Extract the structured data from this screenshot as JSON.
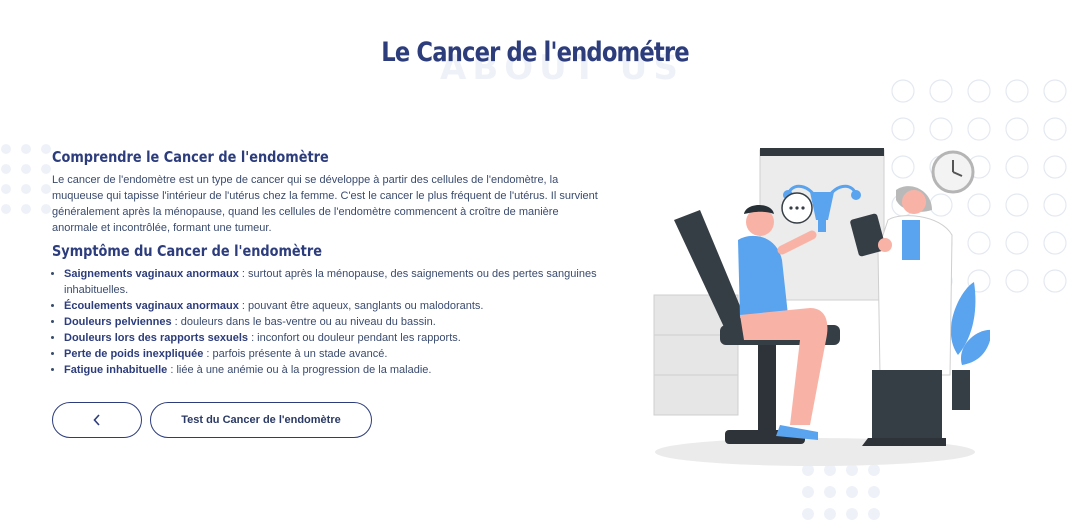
{
  "page": {
    "watermark": "ABOUT US",
    "title": "Le Cancer de l'endométre"
  },
  "section1": {
    "heading": "Comprendre le Cancer de l'endomètre",
    "text": "Le cancer de l'endomètre est un type de cancer qui se développe à partir des cellules de l'endomètre, la muqueuse qui tapisse l'intérieur de l'utérus chez la femme. C'est le cancer le plus fréquent de l'utérus. Il survient généralement après la ménopause, quand les cellules de l'endomètre commencent à croître de manière anormale et incontrôlée, formant une tumeur."
  },
  "section2": {
    "heading": "Symptôme du Cancer de l'endomètre",
    "items": [
      {
        "term": "Saignements vaginaux anormaux",
        "desc": " : surtout après la ménopause, des saignements ou des pertes sanguines inhabituelles."
      },
      {
        "term": "Écoulements vaginaux anormaux",
        "desc": " : pouvant être aqueux, sanglants ou malodorants."
      },
      {
        "term": "Douleurs pelviennes",
        "desc": " : douleurs dans le bas-ventre ou au niveau du bassin."
      },
      {
        "term": "Douleurs lors des rapports sexuels",
        "desc": " : inconfort ou douleur pendant les rapports."
      },
      {
        "term": "Perte de poids inexpliquée",
        "desc": " : parfois présente à un stade avancé."
      },
      {
        "term": "Fatigue inhabituelle",
        "desc": " : liée à une anémie ou à la progression de la maladie."
      }
    ]
  },
  "buttons": {
    "back_icon": "chevron-left-icon",
    "back_label": "‹",
    "test_label": "Test du Cancer de l'endomètre"
  },
  "colors": {
    "primary": "#2d3d7c",
    "accent": "#5aa3ee",
    "skin": "#f9b3a6"
  }
}
